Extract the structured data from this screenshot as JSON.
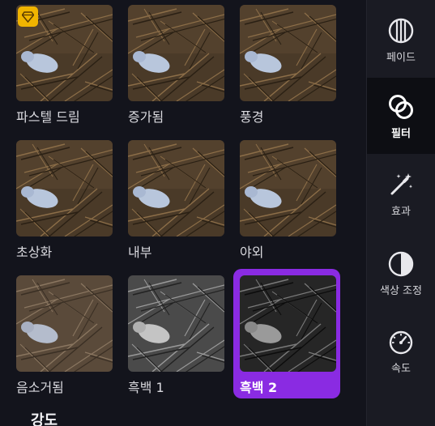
{
  "filters": [
    {
      "label": "파스텔 드림",
      "style": "normal",
      "premium": true
    },
    {
      "label": "증가됨",
      "style": "normal",
      "premium": false
    },
    {
      "label": "풍경",
      "style": "normal",
      "premium": false
    },
    {
      "label": "초상화",
      "style": "normal",
      "premium": false
    },
    {
      "label": "내부",
      "style": "normal",
      "premium": false
    },
    {
      "label": "야외",
      "style": "normal",
      "premium": false
    },
    {
      "label": "음소거됨",
      "style": "muted",
      "premium": false
    },
    {
      "label": "흑백 1",
      "style": "bw",
      "premium": false
    },
    {
      "label": "흑백 2",
      "style": "bw-dark",
      "premium": false,
      "selected": true
    }
  ],
  "intensity_label": "강도",
  "sidebar": {
    "items": [
      {
        "label": "페이드",
        "icon": "fade-icon"
      },
      {
        "label": "필터",
        "icon": "filter-icon",
        "active": true
      },
      {
        "label": "효과",
        "icon": "magic-wand-icon"
      },
      {
        "label": "색상 조정",
        "icon": "color-adjust-icon"
      },
      {
        "label": "속도",
        "icon": "speedometer-icon"
      }
    ]
  },
  "colors": {
    "accent": "#8a2be2",
    "premium_badge": "#f0b400",
    "background": "#13141c",
    "sidebar_bg": "#1a1b23"
  }
}
